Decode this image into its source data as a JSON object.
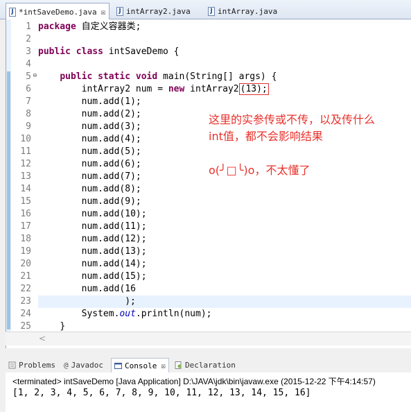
{
  "editor_tabs": [
    {
      "label": "*intSaveDemo.java",
      "close": "☒"
    },
    {
      "label": "intArray2.java"
    },
    {
      "label": "intArray.java"
    }
  ],
  "line_numbers": [
    "1",
    "2",
    "3",
    "4",
    "5",
    "6",
    "7",
    "8",
    "9",
    "10",
    "11",
    "12",
    "13",
    "14",
    "15",
    "16",
    "17",
    "18",
    "19",
    "20",
    "21",
    "22",
    "23",
    "24",
    "25"
  ],
  "code": {
    "l1_kw": "package",
    "l1_rest": " 自定义容器类;",
    "l3_kw1": "public",
    "l3_kw2": "class",
    "l3_rest": " intSaveDemo {",
    "l5_kw1": "public",
    "l5_kw2": "static",
    "l5_kw3": "void",
    "l5_rest": " main(String[] args) {",
    "l6_a": "intArray2 num = ",
    "l6_kw": "new",
    "l6_b": " intArray2",
    "l6_boxed": "(13);",
    "adds": [
      "num.add(1);",
      "num.add(2);",
      "num.add(3);",
      "num.add(4);",
      "num.add(5);",
      "num.add(6);",
      "num.add(7);",
      "num.add(8);",
      "num.add(9);",
      "num.add(10);",
      "num.add(11);",
      "num.add(12);",
      "num.add(13);",
      "num.add(14);",
      "num.add(15);"
    ],
    "l22": "num.add(16",
    "l23": ");",
    "l24_a": "System.",
    "l24_out": "out",
    "l24_b": ".println(num);",
    "l25": "}"
  },
  "annotations": {
    "line1": "这里的实参传或不传，以及传什么",
    "line2": "int值，都不会影响结果",
    "line3": "o(╯□╰)o，不太懂了"
  },
  "fold_marker": "⊖",
  "scroll_left_arrow": "<",
  "views": {
    "tabs": [
      {
        "label": "Problems"
      },
      {
        "label": "Javadoc",
        "icon": "@"
      },
      {
        "label": "Console",
        "close": "☒"
      },
      {
        "label": "Declaration"
      }
    ],
    "console_status": "<terminated> intSaveDemo [Java Application] D:\\JAVA\\jdk\\bin\\javaw.exe (2015-12-22 下午4:14:57)",
    "console_output": "[1, 2, 3, 4, 5, 6, 7, 8, 9, 10, 11, 12, 13, 14, 15, 16]"
  },
  "colors": {
    "keyword": "#7f0055",
    "static_field": "#0000c0",
    "annotation": "#e8312b",
    "current_line": "#e8f2fe"
  }
}
